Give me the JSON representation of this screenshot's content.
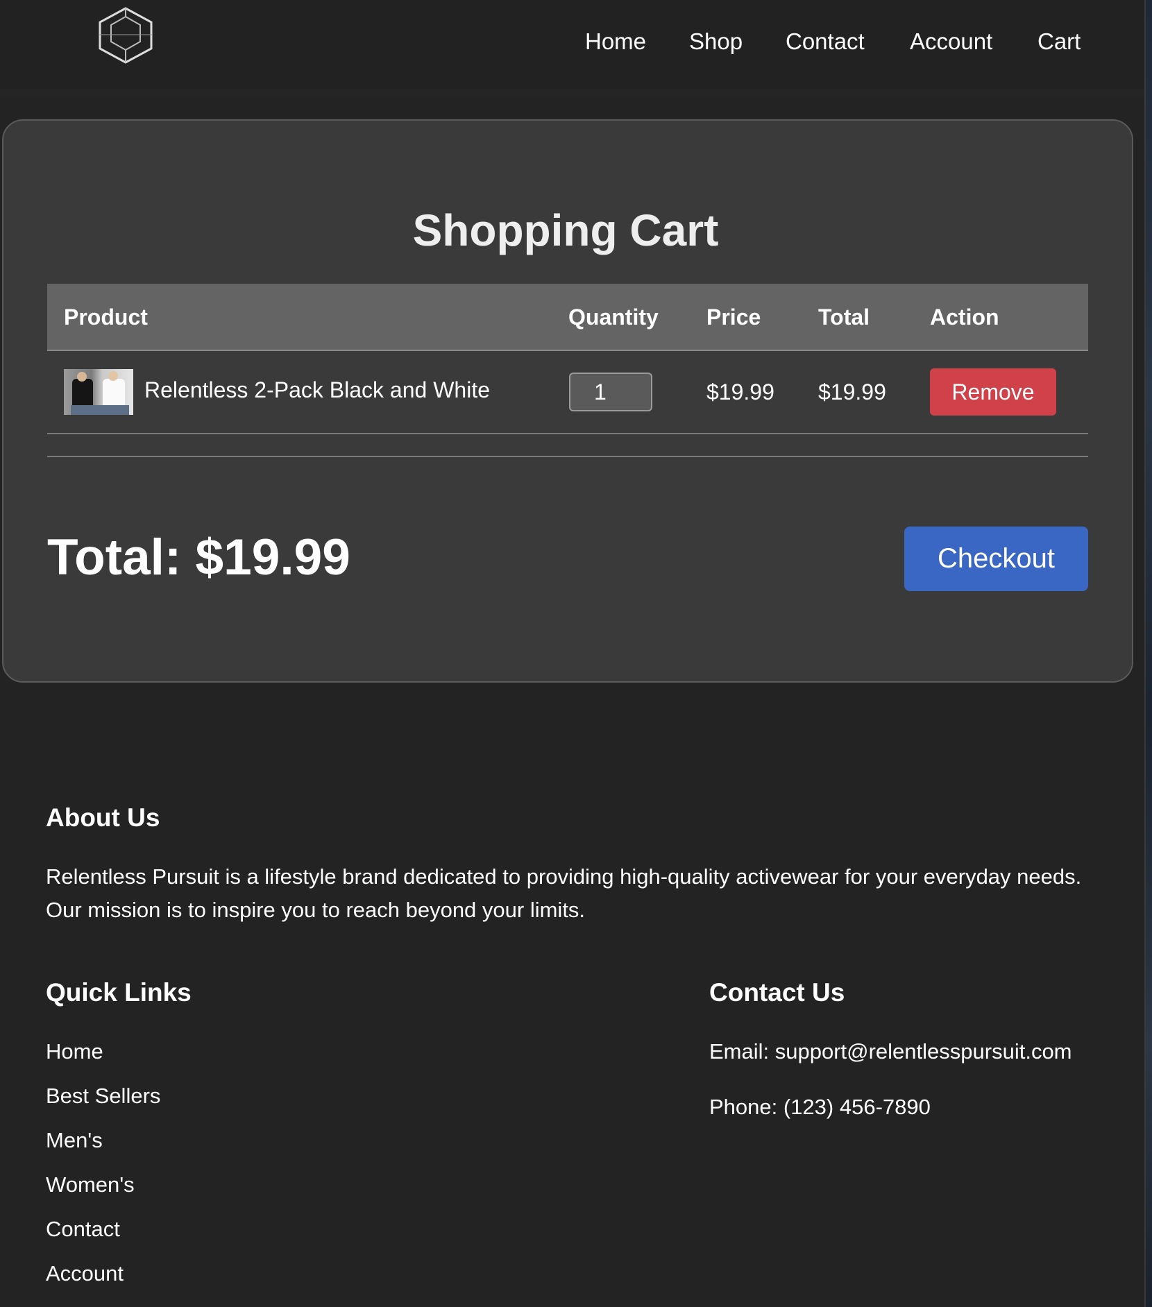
{
  "nav": {
    "items": [
      "Home",
      "Shop",
      "Contact",
      "Account",
      "Cart"
    ]
  },
  "cart": {
    "title": "Shopping Cart",
    "columns": {
      "product": "Product",
      "quantity": "Quantity",
      "price": "Price",
      "total": "Total",
      "action": "Action"
    },
    "items": [
      {
        "name": "Relentless 2-Pack Black and White",
        "quantity": "1",
        "price": "$19.99",
        "total": "$19.99",
        "action_label": "Remove"
      }
    ],
    "total_label": "Total: $19.99",
    "checkout_label": "Checkout"
  },
  "footer": {
    "about_heading": "About Us",
    "about_text": "Relentless Pursuit is a lifestyle brand dedicated to providing high-quality activewear for your everyday needs. Our mission is to inspire you to reach beyond your limits.",
    "quick_links_heading": "Quick Links",
    "quick_links": [
      "Home",
      "Best Sellers",
      "Men's",
      "Women's",
      "Contact",
      "Account"
    ],
    "contact_heading": "Contact Us",
    "email": "Email: support@relentlesspursuit.com",
    "phone": "Phone: (123) 456-7890"
  },
  "colors": {
    "page_bg": "#232323",
    "card_bg": "#3a3a3a",
    "table_header_bg": "#646464",
    "remove_button": "#d0414a",
    "checkout_button": "#3a66c4"
  },
  "icons": {
    "logo": "hexagon-logo-icon"
  }
}
